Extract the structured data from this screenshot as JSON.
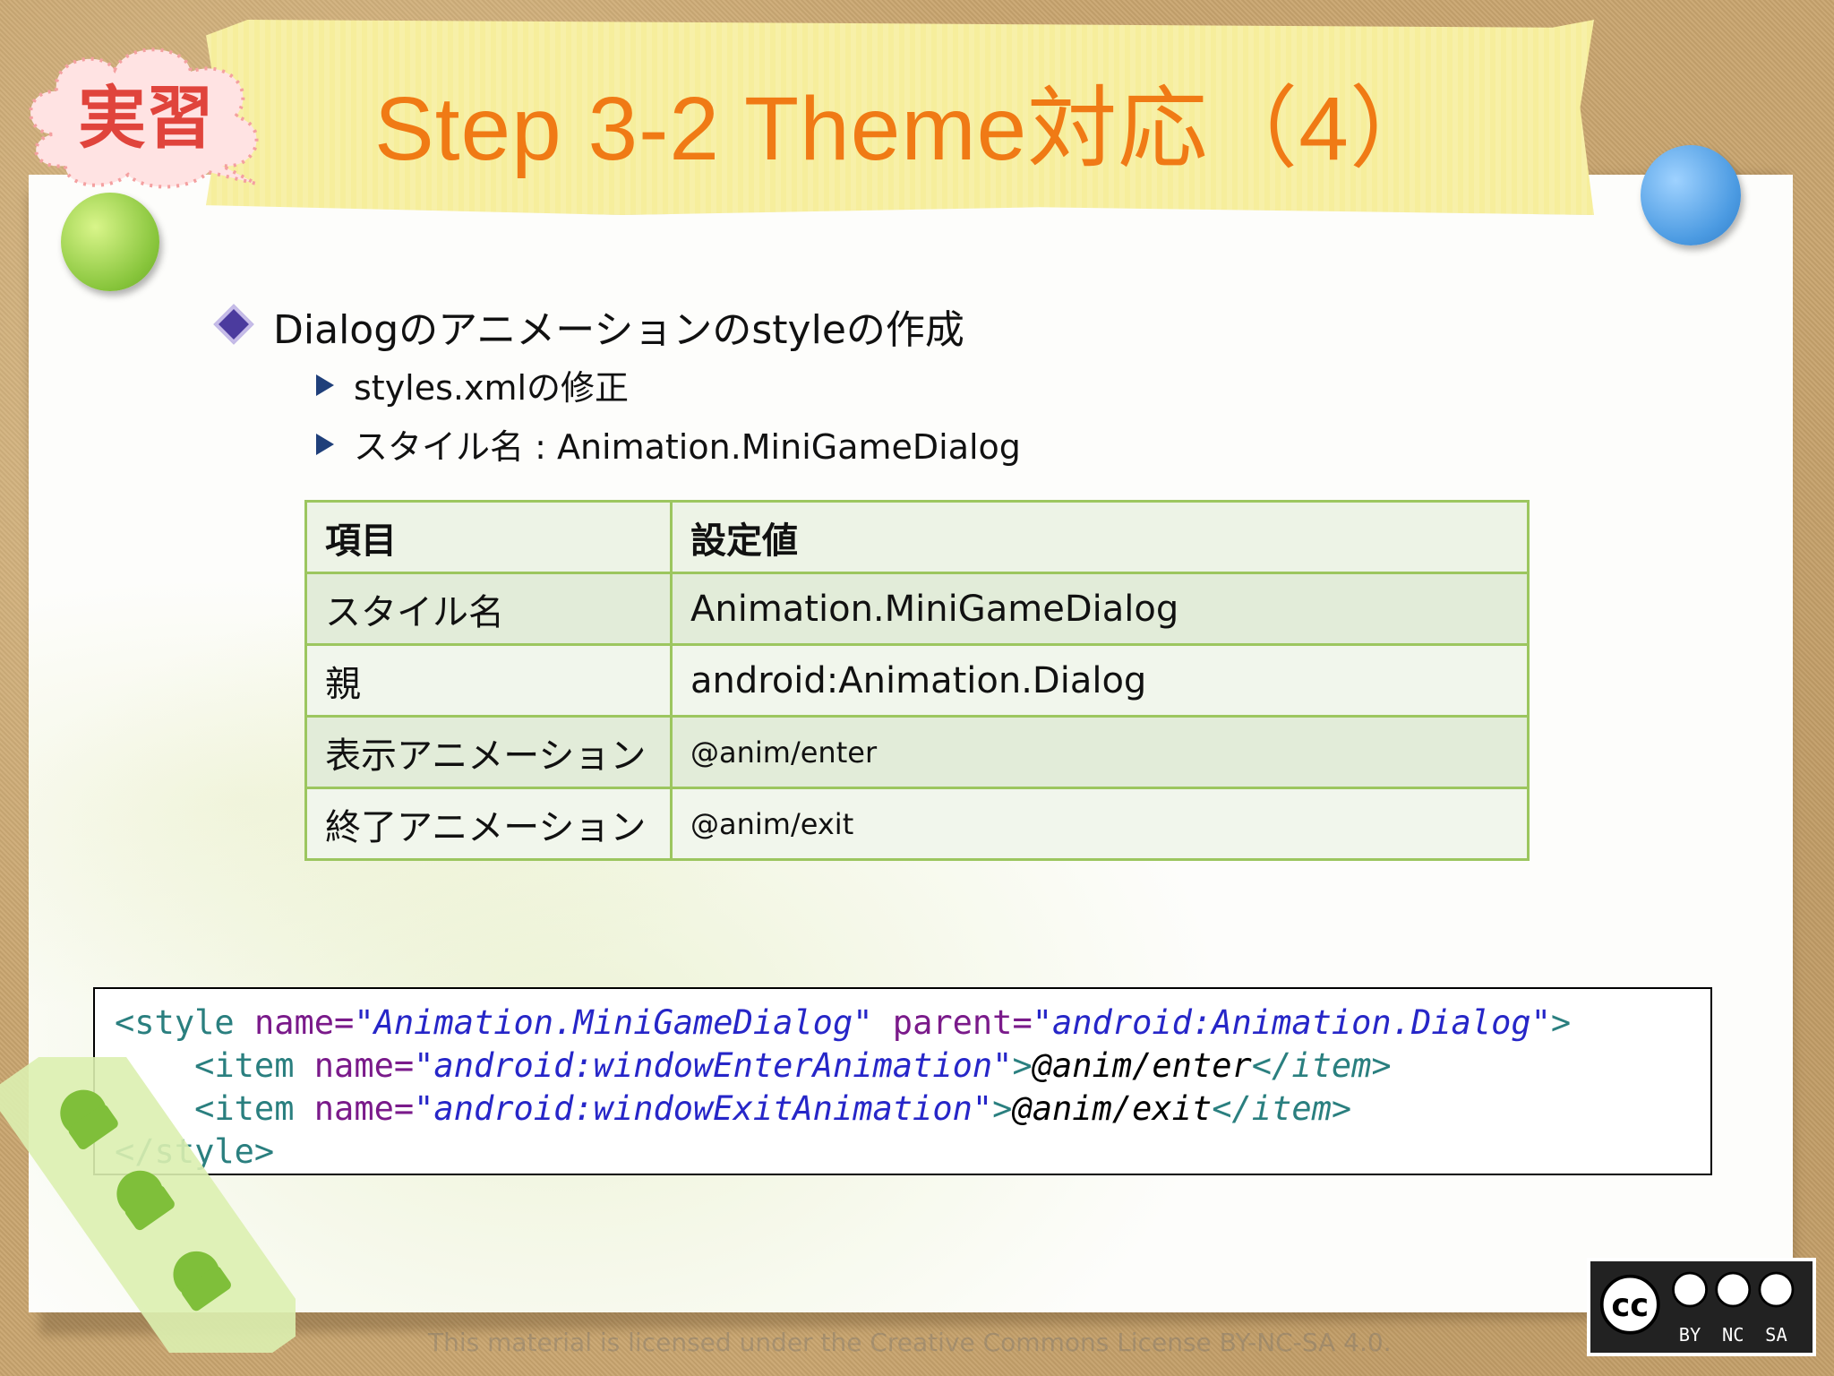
{
  "header": {
    "badge": "実習",
    "title": "Step 3-2 Theme対応（4）"
  },
  "bullets": {
    "main": "Dialogのアニメーションのstyleの作成",
    "sub1": "styles.xmlの修正",
    "sub2": "スタイル名 : Animation.MiniGameDialog"
  },
  "table": {
    "headers": [
      "項目",
      "設定値"
    ],
    "rows": [
      [
        "スタイル名",
        "Animation.MiniGameDialog"
      ],
      [
        "親",
        "android:Animation.Dialog"
      ],
      [
        "表示アニメーション",
        "@anim/enter"
      ],
      [
        "終了アニメーション",
        "@anim/exit"
      ]
    ]
  },
  "code": {
    "line1": {
      "open": "<style ",
      "attr1": "name=",
      "val1": "\"Animation.MiniGameDialog\"",
      "attr2": " parent=",
      "val2": "\"android:Animation.Dialog\"",
      "close": ">"
    },
    "line2": {
      "indent": "    ",
      "open": "<item ",
      "attr": "name=",
      "val": "\"android:windowEnterAnimation\"",
      "gt": ">",
      "text": "@anim/enter",
      "end": "</item>"
    },
    "line3": {
      "indent": "    ",
      "open": "<item ",
      "attr": "name=",
      "val": "\"android:windowExitAnimation\"",
      "gt": ">",
      "text": "@anim/exit",
      "end": "</item>"
    },
    "line4": "</style>"
  },
  "footer": {
    "license_text": "This material is licensed under the Creative Commons License BY-NC-SA 4.0.",
    "cc_labels": [
      "BY",
      "NC",
      "SA"
    ],
    "cc_mark": "cc"
  },
  "colors": {
    "title": "#f07a15",
    "tape": "#f6ee9c",
    "table_border": "#9cc65f",
    "code_tag": "#2a7f7f",
    "code_attr": "#7a1a8a",
    "code_value": "#2626c8"
  },
  "icons": [
    "cloud-badge-icon",
    "green-pushpin-icon",
    "blue-pushpin-icon",
    "diamond-bullet-icon",
    "triangle-bullet-icon",
    "android-robot-icon",
    "creative-commons-icon"
  ]
}
